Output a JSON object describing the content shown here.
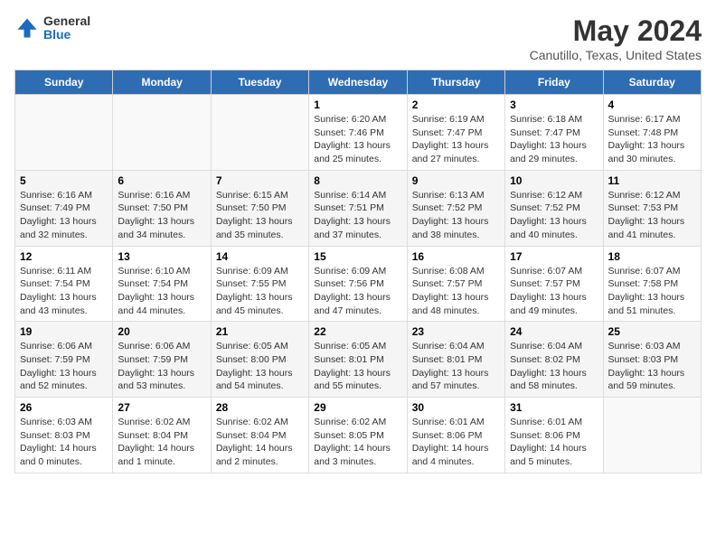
{
  "header": {
    "logo_general": "General",
    "logo_blue": "Blue",
    "title": "May 2024",
    "subtitle": "Canutillo, Texas, United States"
  },
  "weekdays": [
    "Sunday",
    "Monday",
    "Tuesday",
    "Wednesday",
    "Thursday",
    "Friday",
    "Saturday"
  ],
  "weeks": [
    [
      {
        "day": "",
        "info": ""
      },
      {
        "day": "",
        "info": ""
      },
      {
        "day": "",
        "info": ""
      },
      {
        "day": "1",
        "info": "Sunrise: 6:20 AM\nSunset: 7:46 PM\nDaylight: 13 hours\nand 25 minutes."
      },
      {
        "day": "2",
        "info": "Sunrise: 6:19 AM\nSunset: 7:47 PM\nDaylight: 13 hours\nand 27 minutes."
      },
      {
        "day": "3",
        "info": "Sunrise: 6:18 AM\nSunset: 7:47 PM\nDaylight: 13 hours\nand 29 minutes."
      },
      {
        "day": "4",
        "info": "Sunrise: 6:17 AM\nSunset: 7:48 PM\nDaylight: 13 hours\nand 30 minutes."
      }
    ],
    [
      {
        "day": "5",
        "info": "Sunrise: 6:16 AM\nSunset: 7:49 PM\nDaylight: 13 hours\nand 32 minutes."
      },
      {
        "day": "6",
        "info": "Sunrise: 6:16 AM\nSunset: 7:50 PM\nDaylight: 13 hours\nand 34 minutes."
      },
      {
        "day": "7",
        "info": "Sunrise: 6:15 AM\nSunset: 7:50 PM\nDaylight: 13 hours\nand 35 minutes."
      },
      {
        "day": "8",
        "info": "Sunrise: 6:14 AM\nSunset: 7:51 PM\nDaylight: 13 hours\nand 37 minutes."
      },
      {
        "day": "9",
        "info": "Sunrise: 6:13 AM\nSunset: 7:52 PM\nDaylight: 13 hours\nand 38 minutes."
      },
      {
        "day": "10",
        "info": "Sunrise: 6:12 AM\nSunset: 7:52 PM\nDaylight: 13 hours\nand 40 minutes."
      },
      {
        "day": "11",
        "info": "Sunrise: 6:12 AM\nSunset: 7:53 PM\nDaylight: 13 hours\nand 41 minutes."
      }
    ],
    [
      {
        "day": "12",
        "info": "Sunrise: 6:11 AM\nSunset: 7:54 PM\nDaylight: 13 hours\nand 43 minutes."
      },
      {
        "day": "13",
        "info": "Sunrise: 6:10 AM\nSunset: 7:54 PM\nDaylight: 13 hours\nand 44 minutes."
      },
      {
        "day": "14",
        "info": "Sunrise: 6:09 AM\nSunset: 7:55 PM\nDaylight: 13 hours\nand 45 minutes."
      },
      {
        "day": "15",
        "info": "Sunrise: 6:09 AM\nSunset: 7:56 PM\nDaylight: 13 hours\nand 47 minutes."
      },
      {
        "day": "16",
        "info": "Sunrise: 6:08 AM\nSunset: 7:57 PM\nDaylight: 13 hours\nand 48 minutes."
      },
      {
        "day": "17",
        "info": "Sunrise: 6:07 AM\nSunset: 7:57 PM\nDaylight: 13 hours\nand 49 minutes."
      },
      {
        "day": "18",
        "info": "Sunrise: 6:07 AM\nSunset: 7:58 PM\nDaylight: 13 hours\nand 51 minutes."
      }
    ],
    [
      {
        "day": "19",
        "info": "Sunrise: 6:06 AM\nSunset: 7:59 PM\nDaylight: 13 hours\nand 52 minutes."
      },
      {
        "day": "20",
        "info": "Sunrise: 6:06 AM\nSunset: 7:59 PM\nDaylight: 13 hours\nand 53 minutes."
      },
      {
        "day": "21",
        "info": "Sunrise: 6:05 AM\nSunset: 8:00 PM\nDaylight: 13 hours\nand 54 minutes."
      },
      {
        "day": "22",
        "info": "Sunrise: 6:05 AM\nSunset: 8:01 PM\nDaylight: 13 hours\nand 55 minutes."
      },
      {
        "day": "23",
        "info": "Sunrise: 6:04 AM\nSunset: 8:01 PM\nDaylight: 13 hours\nand 57 minutes."
      },
      {
        "day": "24",
        "info": "Sunrise: 6:04 AM\nSunset: 8:02 PM\nDaylight: 13 hours\nand 58 minutes."
      },
      {
        "day": "25",
        "info": "Sunrise: 6:03 AM\nSunset: 8:03 PM\nDaylight: 13 hours\nand 59 minutes."
      }
    ],
    [
      {
        "day": "26",
        "info": "Sunrise: 6:03 AM\nSunset: 8:03 PM\nDaylight: 14 hours\nand 0 minutes."
      },
      {
        "day": "27",
        "info": "Sunrise: 6:02 AM\nSunset: 8:04 PM\nDaylight: 14 hours\nand 1 minute."
      },
      {
        "day": "28",
        "info": "Sunrise: 6:02 AM\nSunset: 8:04 PM\nDaylight: 14 hours\nand 2 minutes."
      },
      {
        "day": "29",
        "info": "Sunrise: 6:02 AM\nSunset: 8:05 PM\nDaylight: 14 hours\nand 3 minutes."
      },
      {
        "day": "30",
        "info": "Sunrise: 6:01 AM\nSunset: 8:06 PM\nDaylight: 14 hours\nand 4 minutes."
      },
      {
        "day": "31",
        "info": "Sunrise: 6:01 AM\nSunset: 8:06 PM\nDaylight: 14 hours\nand 5 minutes."
      },
      {
        "day": "",
        "info": ""
      }
    ]
  ]
}
